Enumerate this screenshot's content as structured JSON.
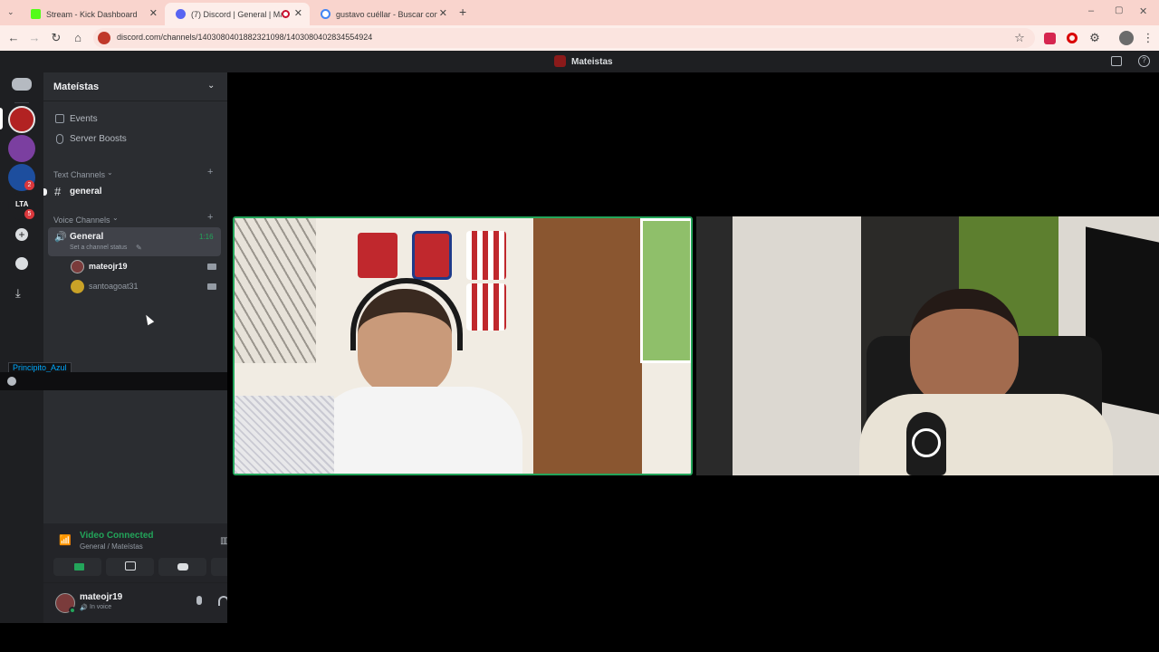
{
  "browser": {
    "tabs": [
      {
        "title": "Stream - Kick Dashboard",
        "favicon_color": "#53fc18"
      },
      {
        "title": "(7) Discord | General | Mate",
        "favicon_color": "#5865f2"
      },
      {
        "title": "gustavo cuéllar - Buscar con Go",
        "favicon_color": "#4285f4"
      }
    ],
    "new_tab": "+",
    "url": "discord.com/channels/1403080401882321098/1403080402834554924"
  },
  "discord": {
    "window_title": "Mateistas",
    "server_name": "Mateístas",
    "events_label": "Events",
    "boosts_label": "Server Boosts",
    "text_channels_label": "Text Channels",
    "text_channel": "general",
    "voice_channels_label": "Voice Channels",
    "voice_channel": "General",
    "voice_timer": "1:16",
    "status_prompt": "Set a channel status",
    "members": [
      "mateojr19",
      "santoagoat31"
    ],
    "hover_user": "Principito_Azul",
    "server_badges": [
      "2",
      "5"
    ],
    "lta_label": "LTA",
    "connection": {
      "status": "Video Connected",
      "location": "General / Mateístas"
    },
    "user": {
      "name": "mateojr19",
      "state": "In voice"
    },
    "accent_green": "#23a55a"
  }
}
